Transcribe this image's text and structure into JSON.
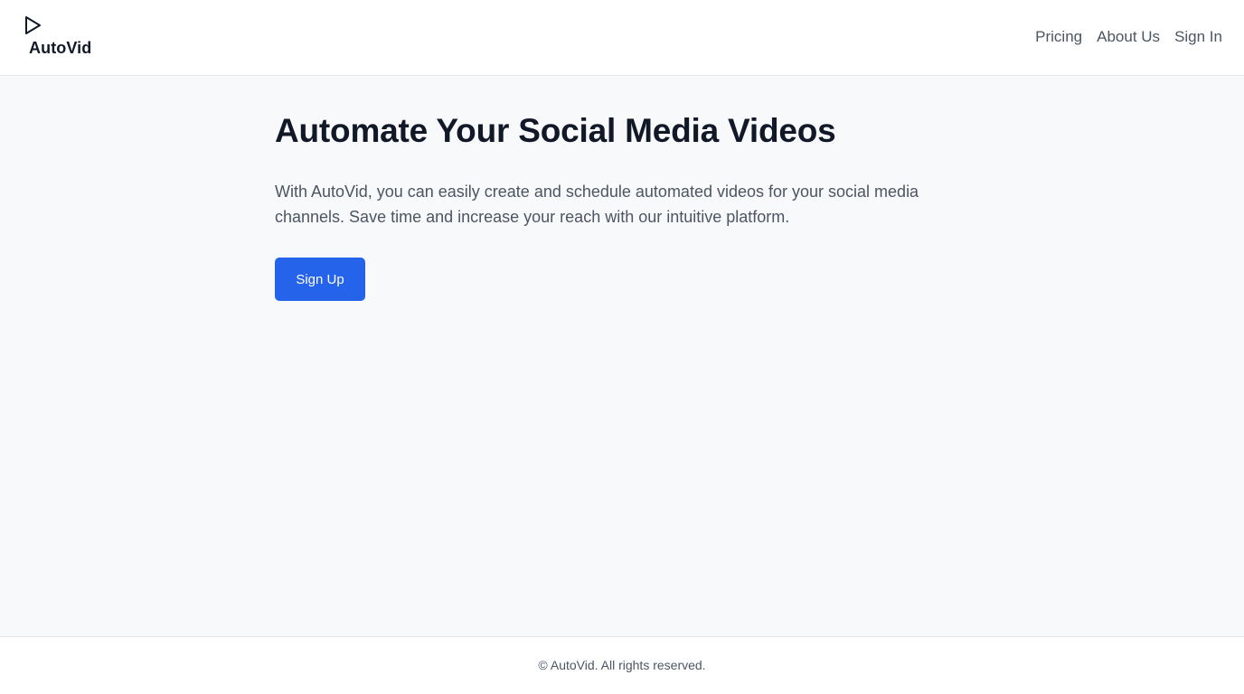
{
  "header": {
    "brand_name": "AutoVid",
    "brand_icon": "play-icon",
    "nav": {
      "pricing": "Pricing",
      "about": "About Us",
      "sign_in": "Sign In"
    }
  },
  "hero": {
    "title": "Automate Your Social Media Videos",
    "description": "With AutoVid, you can easily create and schedule automated videos for your social media channels. Save time and increase your reach with our intuitive platform.",
    "cta_label": "Sign Up"
  },
  "footer": {
    "copyright": "© AutoVid. All rights reserved."
  },
  "colors": {
    "accent": "#2563eb",
    "page_background": "#f8f9fb",
    "text_primary": "#111827",
    "text_secondary": "#4b5563"
  }
}
